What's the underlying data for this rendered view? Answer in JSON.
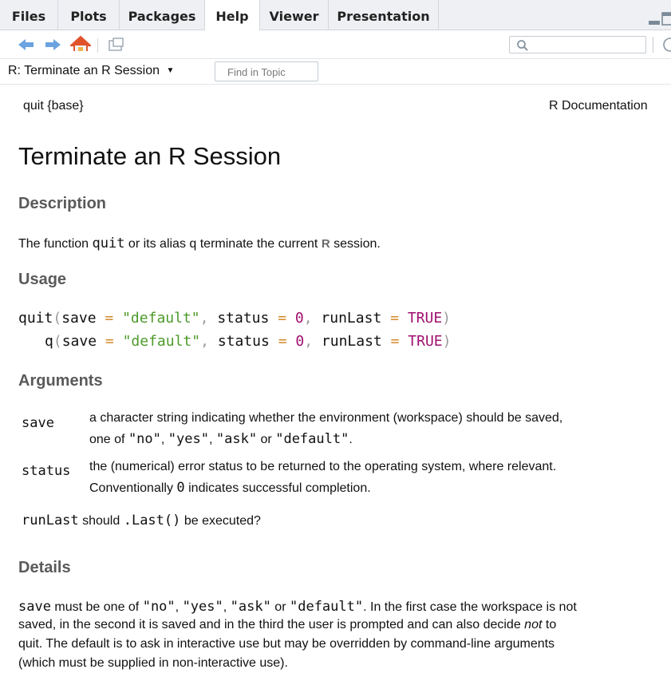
{
  "tabs": [
    {
      "label": "Files"
    },
    {
      "label": "Plots"
    },
    {
      "label": "Packages"
    },
    {
      "label": "Help"
    },
    {
      "label": "Viewer"
    },
    {
      "label": "Presentation"
    }
  ],
  "active_tab": "Help",
  "toolbar": {
    "icons": [
      "back-arrow-icon",
      "forward-arrow-icon",
      "home-icon",
      "open-in-window-icon",
      "search-icon",
      "refresh-icon"
    ],
    "search_value": ""
  },
  "topic": {
    "title": "R: Terminate an R Session",
    "find_placeholder": "Find in Topic"
  },
  "doc": {
    "pkg_ref": "quit {base}",
    "r_documentation": "R Documentation",
    "title": "Terminate an R Session",
    "description": {
      "heading": "Description",
      "text_1": "The function",
      "code_quit": "quit",
      "text_2": "or its alias q terminate the current",
      "r_logo": "R",
      "text_3": "session."
    },
    "usage": {
      "heading": "Usage",
      "line1": {
        "fn": "quit",
        "arg1": "save",
        "val1": "\"default\"",
        "arg2": "status",
        "val2": "0",
        "arg3": "runLast",
        "val3": "TRUE"
      },
      "line2": {
        "fn": "q",
        "arg1": "save",
        "val1": "\"default\"",
        "arg2": "status",
        "val2": "0",
        "arg3": "runLast",
        "val3": "TRUE"
      }
    },
    "arguments": {
      "heading": "Arguments",
      "save": {
        "name": "save",
        "line1": "a character string indicating whether the environment (workspace) should be saved,",
        "line2_pre": "one of",
        "opt_no": "\"no\"",
        "opt_yes": "\"yes\"",
        "opt_ask": "\"ask\"",
        "or": "or",
        "opt_default": "\"default\"",
        "period": "."
      },
      "status": {
        "name": "status",
        "line1": "the (numerical) error status to be returned to the operating system, where relevant.",
        "line2_pre": "Conventionally",
        "zero": "0",
        "line2_post": "indicates successful completion."
      },
      "runLast": {
        "name": "runLast",
        "pre": "should",
        "code": ".Last()",
        "post": "be executed?"
      }
    },
    "details": {
      "heading": "Details",
      "code_save": "save",
      "l1_a": "must be one of",
      "opt_no": "\"no\"",
      "opt_yes": "\"yes\"",
      "opt_ask": "\"ask\"",
      "or": "or",
      "opt_default": "\"default\"",
      "l1_b": ". In the first case the workspace is not",
      "l2_a": "saved, in the second it is saved and in the third the user is prompted and can also decide",
      "l2_not": "not",
      "l2_b": "to",
      "l3": "quit. The default is to ask in interactive use but may be overridden by command-line arguments",
      "l4": "(which must be supplied in non-interactive use)."
    }
  },
  "colors": {
    "string": "#4c9a2a",
    "number": "#a0106e",
    "heading": "#5a5a5a",
    "home_icon": "#e0542c",
    "nav_arrow": "#6aa3e0"
  }
}
